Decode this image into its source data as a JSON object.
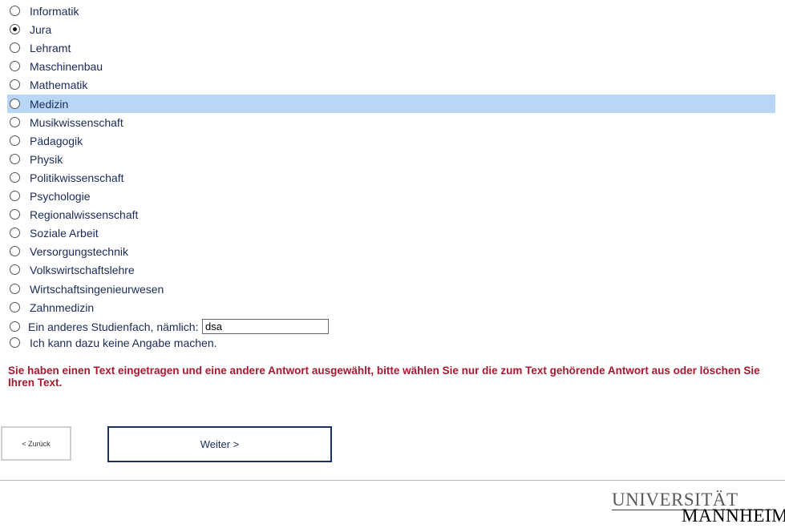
{
  "options": [
    {
      "label": "Informatik",
      "checked": false,
      "highlighted": false
    },
    {
      "label": "Jura",
      "checked": true,
      "highlighted": false
    },
    {
      "label": "Lehramt",
      "checked": false,
      "highlighted": false
    },
    {
      "label": "Maschinenbau",
      "checked": false,
      "highlighted": false
    },
    {
      "label": "Mathematik",
      "checked": false,
      "highlighted": false
    },
    {
      "label": "Medizin",
      "checked": false,
      "highlighted": true
    },
    {
      "label": "Musikwissenschaft",
      "checked": false,
      "highlighted": false
    },
    {
      "label": "Pädagogik",
      "checked": false,
      "highlighted": false
    },
    {
      "label": "Physik",
      "checked": false,
      "highlighted": false
    },
    {
      "label": "Politikwissenschaft",
      "checked": false,
      "highlighted": false
    },
    {
      "label": "Psychologie",
      "checked": false,
      "highlighted": false
    },
    {
      "label": "Regionalwissenschaft",
      "checked": false,
      "highlighted": false
    },
    {
      "label": "Soziale Arbeit",
      "checked": false,
      "highlighted": false
    },
    {
      "label": "Versorgungstechnik",
      "checked": false,
      "highlighted": false
    },
    {
      "label": "Volkswirtschaftslehre",
      "checked": false,
      "highlighted": false
    },
    {
      "label": "Wirtschaftsingenieurwesen",
      "checked": false,
      "highlighted": false
    },
    {
      "label": "Zahnmedizin",
      "checked": false,
      "highlighted": false
    }
  ],
  "other_option": {
    "label": "Ein anderes Studienfach, nämlich:",
    "value": "dsa",
    "checked": false
  },
  "no_answer_option": {
    "label": "Ich kann dazu keine Angabe machen.",
    "checked": false
  },
  "error_message": "Sie haben einen Text eingetragen und eine andere Antwort ausgewählt, bitte wählen Sie nur die zum Text gehörende Antwort aus oder löschen Sie Ihren Text.",
  "nav": {
    "back_label": "< Zurück",
    "next_label": "Weiter >"
  },
  "logo": {
    "line1": "UNIVERSITÄT",
    "line2": "MANNHEIM"
  },
  "colors": {
    "text": "#1a2a5a",
    "highlight": "#b8d6f6",
    "error": "#a8192e",
    "button_border": "#1b2e66"
  }
}
